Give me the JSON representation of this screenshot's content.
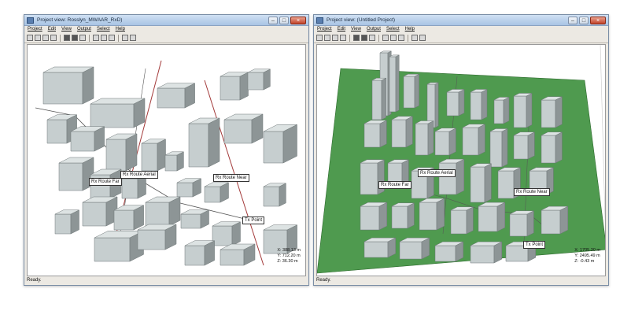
{
  "windows": [
    {
      "title": "Project view: Rosslyn_MWAAR_RxD)",
      "menu": [
        "Project",
        "Edit",
        "View",
        "Output",
        "Select",
        "Help"
      ],
      "labels": {
        "rx_route_aerial": "Rx Route Aerial",
        "rx_route_far": "Rx Route Far",
        "rx_route_near": "Rx Route Near",
        "tx_point": "Tx Point"
      },
      "coords": {
        "x": "X: 388.13 m",
        "y": "Y: 712.20 m",
        "z": "Z: 36.30 m"
      },
      "status": "Ready."
    },
    {
      "title": "Project view: (Untitled Project)",
      "menu": [
        "Project",
        "Edit",
        "View",
        "Output",
        "Select",
        "Help"
      ],
      "labels": {
        "rx_route_aerial": "Rx Route Aerial",
        "rx_route_far": "Rx Route Far",
        "rx_route_near": "Rx Route Near",
        "tx_point": "Tx Point"
      },
      "coords": {
        "x": "X: 1705.30 m",
        "y": "Y: 2495.49 m",
        "z": "Z: -0.43 m"
      },
      "status": "Ready."
    }
  ],
  "colors": {
    "building_face": "#c6cecf",
    "building_side": "#8d9596",
    "building_top": "#dde3e3",
    "ground_green": "#4f9a4f",
    "route_line": "#555555",
    "street_line": "#a33a3a"
  }
}
